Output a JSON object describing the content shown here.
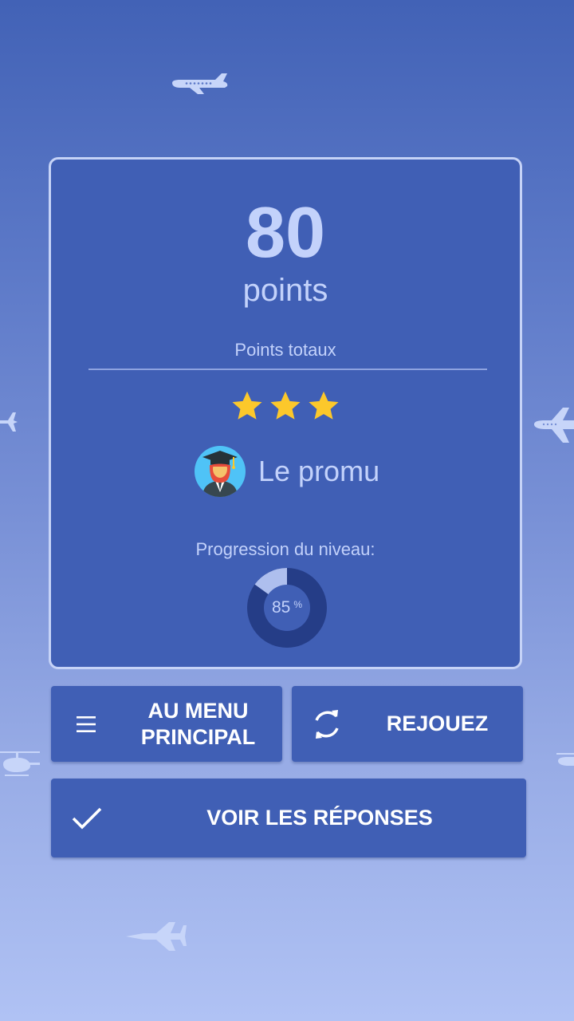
{
  "score": {
    "value": "80",
    "unit": "points",
    "total_label": "Points totaux"
  },
  "rating": {
    "stars_earned": 3,
    "stars_total": 3
  },
  "rank": {
    "icon": "graduate-avatar-icon",
    "label": "Le promu"
  },
  "progress": {
    "label": "Progression du niveau:",
    "value": "85",
    "unit": "%",
    "fraction_shown": 0.15
  },
  "buttons": {
    "menu": {
      "line1": "AU MENU",
      "line2": "PRINCIPAL",
      "icon": "menu-icon"
    },
    "replay": {
      "label": "REJOUEZ",
      "icon": "refresh-icon"
    },
    "answers": {
      "label": "VOIR LES RÉPONSES",
      "icon": "checkmark-icon"
    }
  },
  "colors": {
    "card": "#405fb5",
    "card_border": "#c6d3f7",
    "text_light": "#c3d2fb",
    "star": "#fcc82b",
    "ring_track": "#253d87",
    "ring_fill": "#aebfee"
  }
}
